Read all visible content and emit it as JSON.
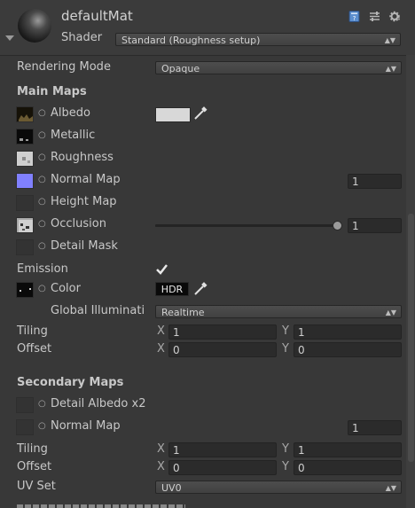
{
  "header": {
    "material_name": "defaultMat",
    "shader_label": "Shader",
    "shader_value": "Standard (Roughness setup)",
    "icons": [
      "help-book-icon",
      "presets-icon",
      "gear-icon"
    ]
  },
  "rendering_mode": {
    "label": "Rendering Mode",
    "value": "Opaque"
  },
  "main_maps": {
    "title": "Main Maps",
    "albedo": "Albedo",
    "metallic": "Metallic",
    "roughness": "Roughness",
    "normal_map": "Normal Map",
    "normal_value": "1",
    "height_map": "Height Map",
    "occlusion": "Occlusion",
    "occlusion_value": "1",
    "occlusion_level": 1.0,
    "detail_mask": "Detail Mask",
    "emission": "Emission",
    "emission_checked": true,
    "color": "Color",
    "hdr_label": "HDR",
    "gi_label": "Global Illuminati",
    "gi_value": "Realtime",
    "tiling": "Tiling",
    "tiling_x": "1",
    "tiling_y": "1",
    "offset": "Offset",
    "offset_x": "0",
    "offset_y": "0",
    "x_lbl": "X",
    "y_lbl": "Y",
    "albedo_color": "#d8d8d8",
    "normal_color": "#8080ff"
  },
  "secondary_maps": {
    "title": "Secondary Maps",
    "detail_albedo": "Detail Albedo x2",
    "normal_map": "Normal Map",
    "normal_value": "1",
    "tiling": "Tiling",
    "tiling_x": "1",
    "tiling_y": "1",
    "offset": "Offset",
    "offset_x": "0",
    "offset_y": "0",
    "x_lbl": "X",
    "y_lbl": "Y",
    "uv_set_label": "UV Set",
    "uv_set_value": "UV0"
  }
}
